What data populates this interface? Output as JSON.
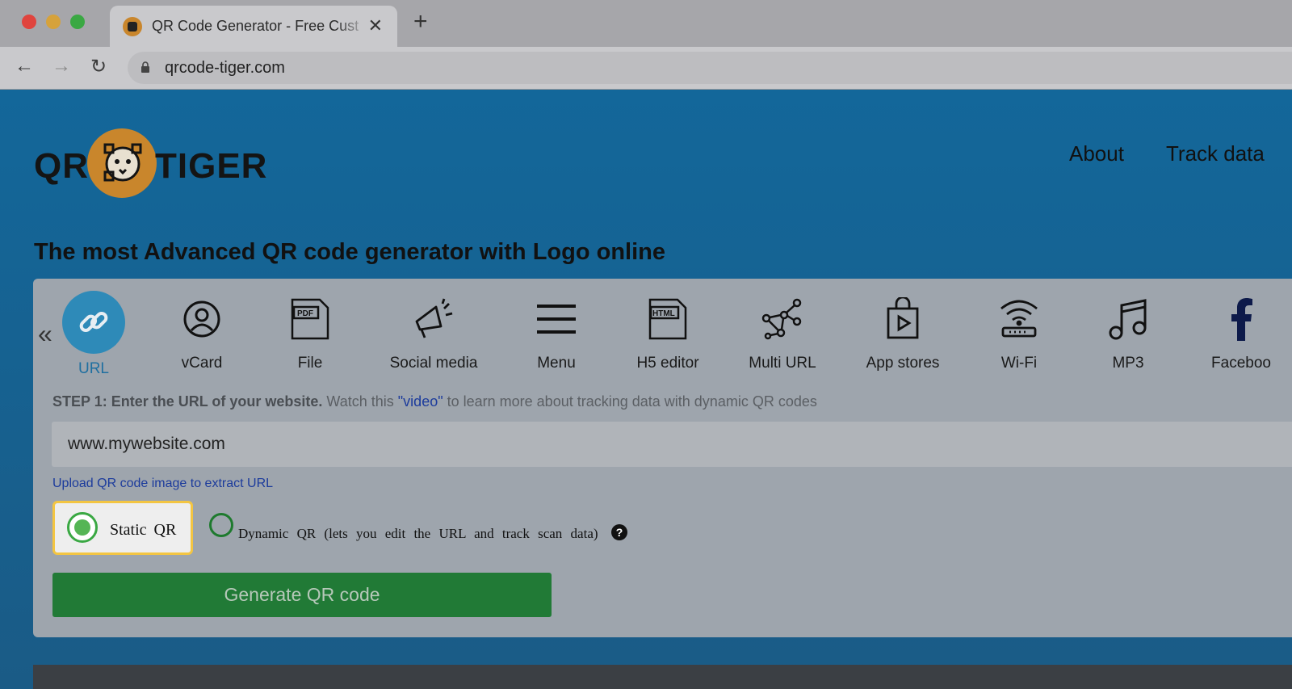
{
  "browser": {
    "tab_title": "QR Code Generator - Free Cust",
    "url": "qrcode-tiger.com"
  },
  "header": {
    "logo_left": "QR",
    "logo_right": "TIGER",
    "nav": [
      "About",
      "Track data"
    ]
  },
  "headline": "The most Advanced QR code generator with Logo online",
  "qr_types": [
    {
      "label": "URL",
      "icon": "link-icon",
      "active": true
    },
    {
      "label": "vCard",
      "icon": "user-circle-icon"
    },
    {
      "label": "File",
      "icon": "pdf-file-icon"
    },
    {
      "label": "Social media",
      "icon": "megaphone-icon"
    },
    {
      "label": "Menu",
      "icon": "hamburger-menu-icon"
    },
    {
      "label": "H5 editor",
      "icon": "html-file-icon"
    },
    {
      "label": "Multi URL",
      "icon": "network-nodes-icon"
    },
    {
      "label": "App stores",
      "icon": "shopping-bag-play-icon"
    },
    {
      "label": "Wi-Fi",
      "icon": "wifi-router-icon"
    },
    {
      "label": "MP3",
      "icon": "music-note-icon"
    },
    {
      "label": "Faceboo",
      "icon": "facebook-icon"
    }
  ],
  "step": {
    "strong": "STEP 1: Enter the URL of your website.",
    "before_link": "Watch this",
    "link": "\"video\"",
    "after_link": "to learn more about tracking data with dynamic QR codes"
  },
  "url_input": {
    "value": "www.mywebsite.com"
  },
  "upload_link": "Upload QR code image to extract URL",
  "options": {
    "static_label": "Static QR",
    "dynamic_label": "Dynamic QR (lets you edit the URL and track scan data)",
    "help": "?"
  },
  "generate_button": "Generate QR code",
  "colors": {
    "accent": "#2e8ab8",
    "page_bg": "#13679a",
    "green_button": "#217a36",
    "highlight": "#f3c542"
  }
}
